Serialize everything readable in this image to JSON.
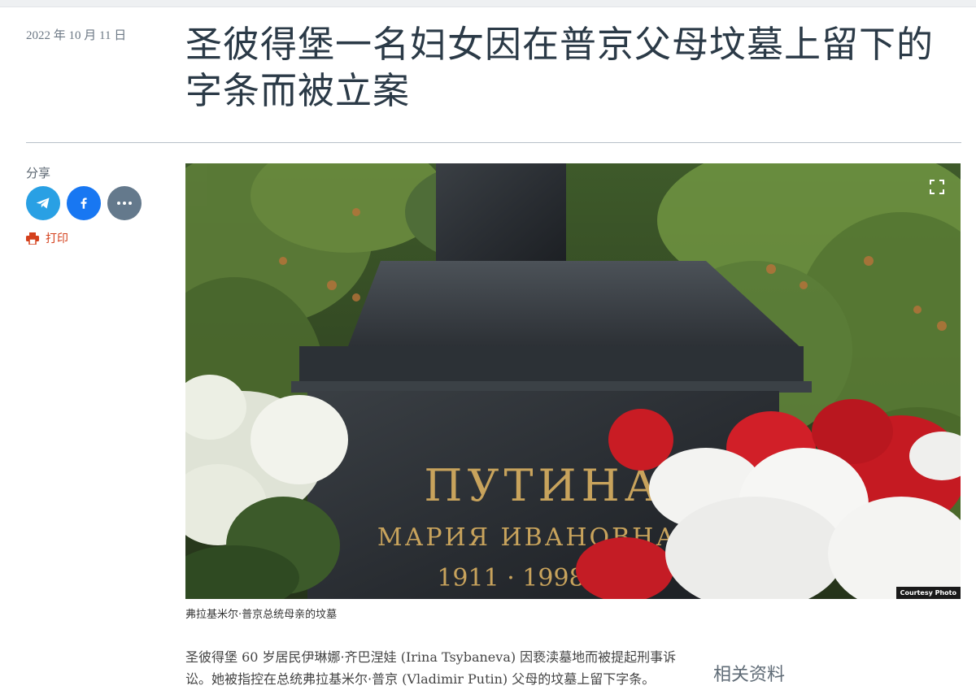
{
  "article": {
    "date": "2022 年 10 月 11 日",
    "title": "圣彼得堡一名妇女因在普京父母坟墓上留下的字条而被立案",
    "caption": "弗拉基米尔·普京总统母亲的坟墓",
    "body": "圣彼得堡 60 岁居民伊琳娜·齐巴涅娃 (Irina Tsybaneva) 因亵渎墓地而被提起刑事诉讼。她被指控在总统弗拉基米尔·普京 (Vladimir Putin) 父母的坟墓上留下字条。"
  },
  "share": {
    "label": "分享",
    "print_label": "打印",
    "buttons": [
      {
        "name": "telegram",
        "icon": "telegram-icon",
        "color": "#29a0e4"
      },
      {
        "name": "facebook",
        "icon": "facebook-icon",
        "color": "#1877f2"
      },
      {
        "name": "more",
        "icon": "more-icon",
        "color": "#64798c"
      }
    ]
  },
  "photo": {
    "credit": "Courtesy Photo",
    "engraving": {
      "surname": "ПУТИНА",
      "name": "МАРИЯ ИВАНОВНА",
      "years": "1911 · 1998"
    }
  },
  "sidebar": {
    "related_label": "相关资料"
  },
  "colors": {
    "accent_print": "#d4401c",
    "title": "#2b3a47"
  }
}
